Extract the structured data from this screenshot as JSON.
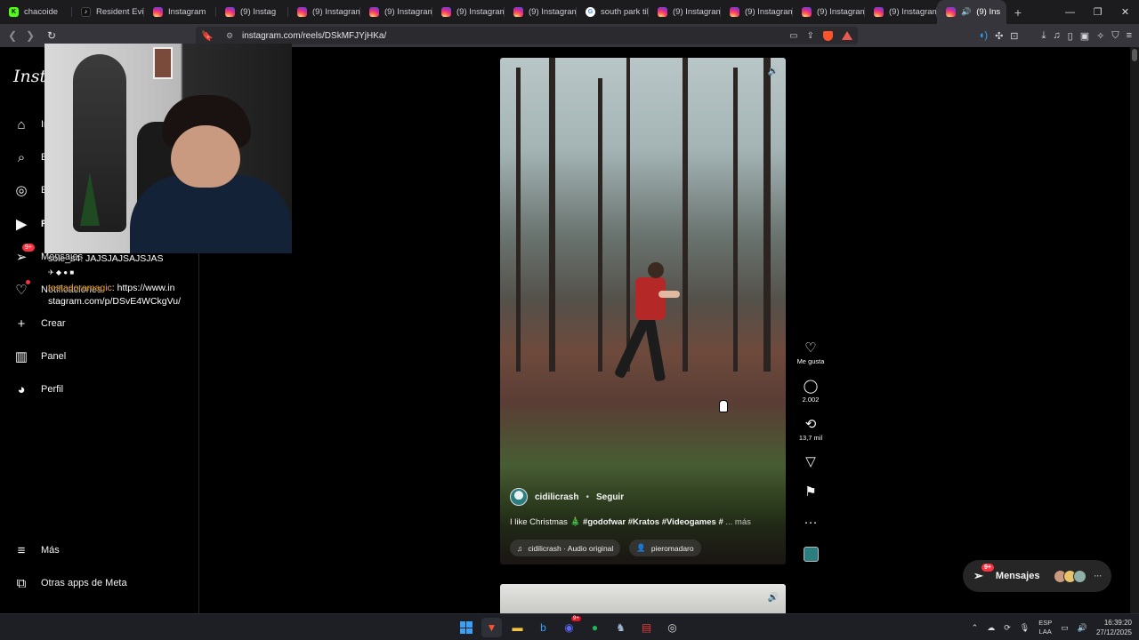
{
  "browser": {
    "tabs": [
      {
        "title": "chacoide",
        "favicon": "kick"
      },
      {
        "title": "Resident Evil",
        "favicon": "tiktok"
      },
      {
        "title": "Instagram",
        "favicon": "instagram"
      },
      {
        "title": "(9) Instag",
        "favicon": "instagram"
      },
      {
        "title": "(9) Instagram",
        "favicon": "instagram"
      },
      {
        "title": "(9) Instagram",
        "favicon": "instagram"
      },
      {
        "title": "(9) Instagram",
        "favicon": "instagram"
      },
      {
        "title": "(9) Instagram",
        "favicon": "instagram"
      },
      {
        "title": "south park til",
        "favicon": "google"
      },
      {
        "title": "(9) Instagram",
        "favicon": "instagram"
      },
      {
        "title": "(9) Instagram",
        "favicon": "instagram"
      },
      {
        "title": "(9) Instagram",
        "favicon": "instagram"
      },
      {
        "title": "(9) Instagram",
        "favicon": "instagram"
      },
      {
        "title": "(9) Ins",
        "favicon": "instagram",
        "active": true
      }
    ],
    "url": "instagram.com/reels/DSkMFJYjHKa/"
  },
  "sidebar": {
    "logo": "Insta",
    "items": [
      {
        "label": "In",
        "icon": "home-icon"
      },
      {
        "label": "B",
        "icon": "search-icon"
      },
      {
        "label": "E",
        "icon": "explore-icon"
      },
      {
        "label": "R",
        "icon": "reels-icon"
      },
      {
        "label": "Mensajes",
        "icon": "messages-icon",
        "badge": "9+"
      },
      {
        "label": "Notificaciones",
        "icon": "heart-icon"
      },
      {
        "label": "Crear",
        "icon": "plus-icon"
      },
      {
        "label": "Panel",
        "icon": "dashboard-icon"
      },
      {
        "label": "Perfil",
        "icon": "profile-avatar"
      }
    ],
    "bottom": [
      {
        "label": "Más",
        "icon": "menu-icon"
      },
      {
        "label": "Otras apps de Meta",
        "icon": "meta-apps-icon"
      }
    ]
  },
  "reel": {
    "author": "cidilicrash",
    "follow": "Seguir",
    "caption_text": "I like Christmas 🎄 ",
    "caption_tags": "#godofwar #Kratos #Videogames #",
    "caption_more": " ... más",
    "audio": "cidilicrash · Audio original",
    "tagged": "pieromadaro"
  },
  "actions": {
    "like_label": "Me gusta",
    "comments": "2.002",
    "reposts": "13,7 mil"
  },
  "messages_button": {
    "label": "Mensajes",
    "badge": "9+"
  },
  "stream_chat": [
    {
      "user": "sole_s4",
      "message": ": JAJSJAJSAJSJAS"
    },
    {
      "user": "tostadoramagic",
      "message": ": https://www.in"
    },
    {
      "user": "",
      "message": "stagram.com/p/DSvE4WCkgVu/"
    }
  ],
  "taskbar": {
    "language": "ESP",
    "language_sub": "LAA",
    "time": "16:39:20",
    "date": "27/12/2025",
    "discord_badge": "9+"
  }
}
